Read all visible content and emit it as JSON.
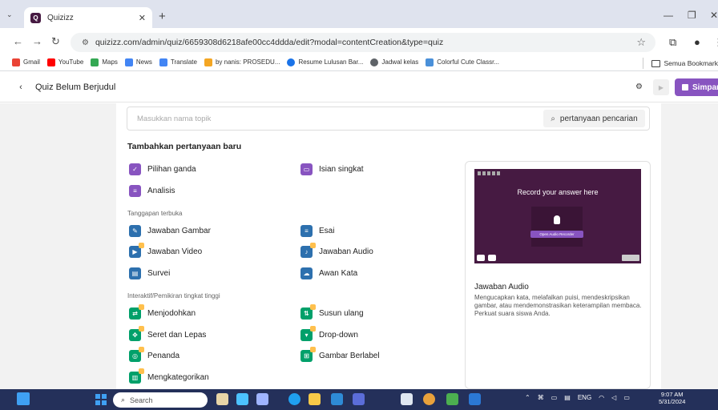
{
  "browser": {
    "tab_title": "Quizizz",
    "url": "quizizz.com/admin/quiz/6659308d6218afe00cc4ddda/edit?modal=contentCreation&type=quiz",
    "bookmarks": [
      {
        "label": "Gmail",
        "color": "#ea4335"
      },
      {
        "label": "YouTube",
        "color": "#ff0000"
      },
      {
        "label": "Maps",
        "color": "#34a853"
      },
      {
        "label": "News",
        "color": "#4285f4"
      },
      {
        "label": "Translate",
        "color": "#4285f4"
      },
      {
        "label": "by nanis: PROSEDU...",
        "color": "#f4a623"
      },
      {
        "label": "Resume Lulusan Bar...",
        "color": "#1a73e8"
      },
      {
        "label": "Jadwal kelas",
        "color": "#5f6368"
      },
      {
        "label": "Colorful Cute Classr...",
        "color": "#4a90d9"
      }
    ],
    "all_bookmarks": "Semua Bookmark"
  },
  "header": {
    "quiz_title": "Quiz Belum Berjudul",
    "save_label": "Simpan",
    "accent": "#8854c0"
  },
  "search": {
    "placeholder": "Masukkan nama topik",
    "button_label": "pertanyaan pencarian"
  },
  "content": {
    "heading": "Tambahkan pertanyaan baru",
    "section_open": "Tanggapan terbuka",
    "section_interactive": "Interaktif/Pemikiran tingkat tinggi",
    "items": {
      "pilihan_ganda": "Pilihan ganda",
      "isian_singkat": "Isian singkat",
      "analisis": "Analisis",
      "jawaban_gambar": "Jawaban Gambar",
      "esai": "Esai",
      "jawaban_video": "Jawaban Video",
      "jawaban_audio": "Jawaban Audio",
      "survei": "Survei",
      "awan_kata": "Awan Kata",
      "menjodohkan": "Menjodohkan",
      "susun_ulang": "Susun ulang",
      "seret_dan_lepas": "Seret dan Lepas",
      "drop_down": "Drop-down",
      "penanda": "Penanda",
      "gambar_berlabel": "Gambar Berlabel",
      "mengkategorikan": "Mengkategorikan"
    }
  },
  "preview": {
    "video_text": "Record your answer here",
    "audio_button": "Open Audio Recorder",
    "title": "Jawaban Audio",
    "description": "Mengucapkan kata, melafalkan puisi, mendeskripsikan gambar, atau mendemonstrasikan keterampilan membaca. Perkuat suara siswa Anda."
  },
  "taskbar": {
    "search_label": "Search",
    "language": "ENG",
    "time": "9:07 AM",
    "date": "5/31/2024"
  }
}
